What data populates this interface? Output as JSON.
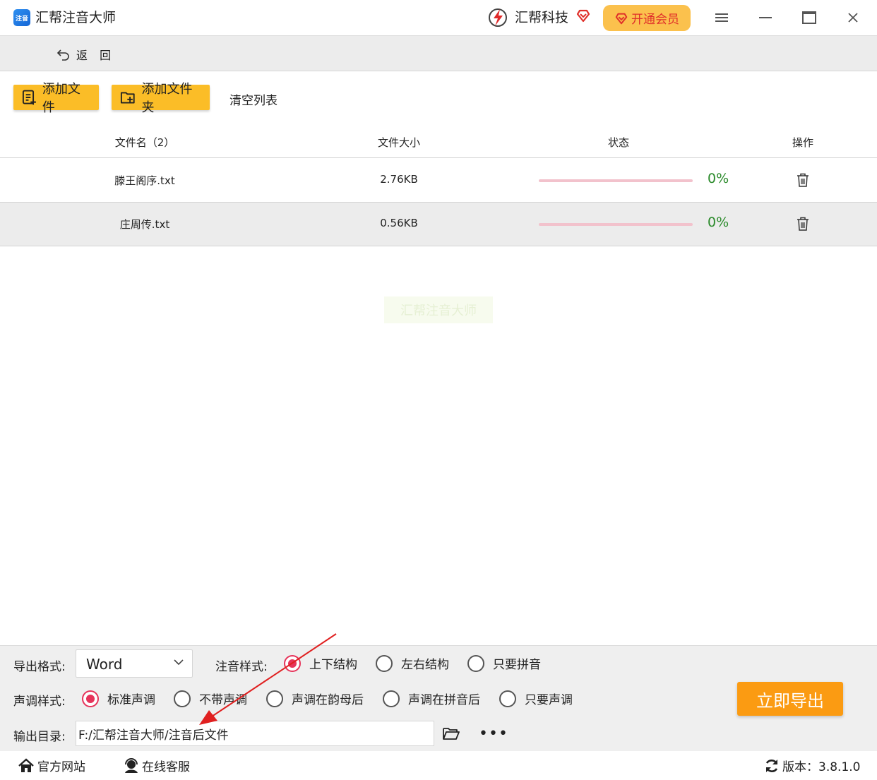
{
  "titlebar": {
    "app_logo_text": "注音",
    "app_title": "汇帮注音大师",
    "brand_name": "汇帮科技",
    "vip_label": "开通会员",
    "icons": [
      "menu-icon",
      "minimize-icon",
      "maximize-icon",
      "close-icon"
    ]
  },
  "backbar": {
    "back_label": "返 回"
  },
  "toolbar": {
    "add_file": "添加文件",
    "add_folder": "添加文件夹",
    "clear_list": "清空列表"
  },
  "table": {
    "headers": {
      "name": "文件名（2）",
      "size": "文件大小",
      "status": "状态",
      "action": "操作"
    },
    "rows": [
      {
        "name": "滕王阁序.txt",
        "size": "2.76KB",
        "progress": 0,
        "percent": "0%"
      },
      {
        "name": "庄周传.txt",
        "size": "0.56KB",
        "progress": 0,
        "percent": "0%"
      }
    ]
  },
  "watermark_text": "汇帮注音大师",
  "options": {
    "format_label": "导出格式:",
    "format_value": "Word",
    "style_label": "注音样式:",
    "styles": [
      {
        "label": "上下结构",
        "selected": true
      },
      {
        "label": "左右结构",
        "selected": false
      },
      {
        "label": "只要拼音",
        "selected": false
      }
    ],
    "tone_label": "声调样式:",
    "tones": [
      {
        "label": "标准声调",
        "selected": true
      },
      {
        "label": "不带声调",
        "selected": false
      },
      {
        "label": "声调在韵母后",
        "selected": false
      },
      {
        "label": "声调在拼音后",
        "selected": false
      },
      {
        "label": "只要声调",
        "selected": false
      }
    ],
    "output_label": "输出目录:",
    "output_path": "F:/汇帮注音大师/注音后文件",
    "more_label": "•••",
    "export_label": "立即导出"
  },
  "footer": {
    "website": "官方网站",
    "support": "在线客服",
    "version": "版本：3.8.1.0"
  },
  "colors": {
    "accent_yellow": "#fbbd27",
    "export_orange": "#fb9b12",
    "radio_red": "#e6335a",
    "percent_green": "#2a8a2a",
    "vip_text_red": "#e0302a"
  }
}
